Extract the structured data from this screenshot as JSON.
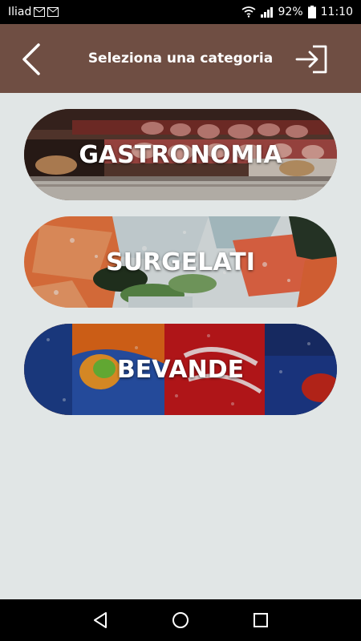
{
  "status_bar": {
    "carrier": "Iliad",
    "battery": "92%",
    "time": "11:10",
    "icons": [
      "message-icon",
      "message-icon",
      "wifi-icon",
      "signal-icon",
      "battery-icon"
    ]
  },
  "app_bar": {
    "title": "Seleziona una categoria",
    "back_icon": "chevron-left-icon",
    "login_icon": "login-icon",
    "background": "#6f4e43"
  },
  "categories": [
    {
      "label": "GASTRONOMIA",
      "image": "deli-counter"
    },
    {
      "label": "SURGELATI",
      "image": "frozen-food"
    },
    {
      "label": "BEVANDE",
      "image": "soda-cans"
    }
  ],
  "nav_bar": {
    "icons": [
      "back-triangle-icon",
      "home-circle-icon",
      "recents-square-icon"
    ]
  },
  "colors": {
    "page_background": "#e1e6e6",
    "app_bar": "#6f4e43",
    "label_text": "#ffffff"
  }
}
